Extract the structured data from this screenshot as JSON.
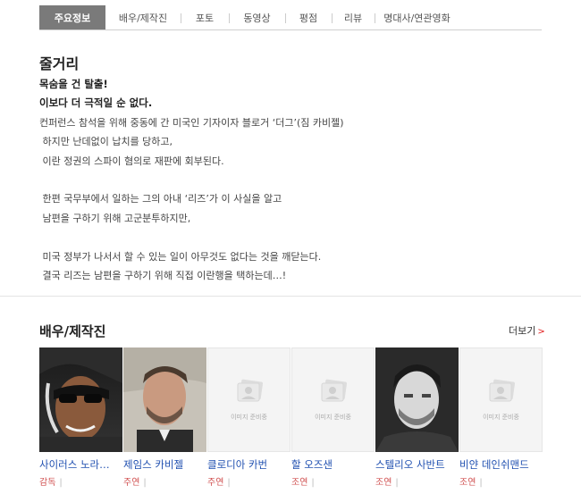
{
  "tabs": [
    {
      "label": "주요정보",
      "active": true
    },
    {
      "label": "배우/제작진",
      "active": false
    },
    {
      "label": "포토",
      "active": false
    },
    {
      "label": "동영상",
      "active": false
    },
    {
      "label": "평점",
      "active": false
    },
    {
      "label": "리뷰",
      "active": false
    },
    {
      "label": "명대사/연관영화",
      "active": false
    }
  ],
  "synopsis": {
    "title": "줄거리",
    "lines": [
      "목숨을 건 탈출!",
      "이보다 더 극적일 순 없다.",
      "컨퍼런스 참석을 위해 중동에 간 미국인 기자이자 블로거 ‘더그’(짐 카비젤)",
      " 하지만 난데없이 납치를 당하고,",
      " 이란 정권의 스파이 혐의로 재판에 회부된다.",
      "",
      " 한편 국무부에서 일하는 그의 아내 ‘리즈’가 이 사실을 알고",
      " 남편을 구하기 위해 고군분투하지만,",
      "",
      " 미국 정부가 나서서 할 수 있는 일이 아무것도 없다는 것을 깨닫는다.",
      " 결국 리즈는 남편을 구하기 위해 직접 이란행을 택하는데…!"
    ]
  },
  "cast_section": {
    "title": "배우/제작진",
    "more_label": "더보기",
    "placeholder_text": "이미지 준비중",
    "members": [
      {
        "name": "사이러스 노라…",
        "role": "감독",
        "photo": "real"
      },
      {
        "name": "제임스 카비젤",
        "role": "주연",
        "photo": "real"
      },
      {
        "name": "클로디아 카번",
        "role": "주연",
        "photo": "placeholder"
      },
      {
        "name": "할 오즈샌",
        "role": "조연",
        "photo": "placeholder"
      },
      {
        "name": "스텔리오 사반트",
        "role": "조연",
        "photo": "real"
      },
      {
        "name": "비얀 데인쉬맨드",
        "role": "조연",
        "photo": "placeholder"
      }
    ]
  }
}
